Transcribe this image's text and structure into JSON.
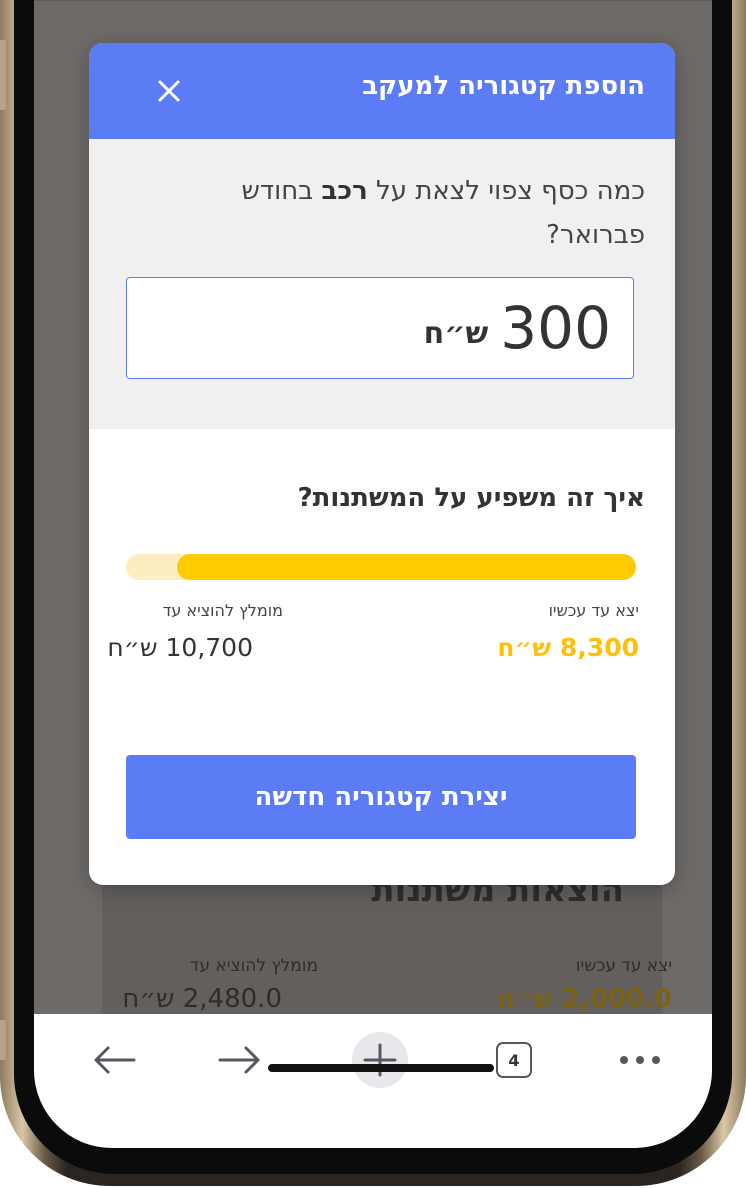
{
  "background": {
    "section_title": "הוצאות משתנות",
    "spent_label": "יצא עד עכשיו",
    "spent_value": "2,000.0 ש״ח",
    "recommended_label": "מומלץ להוציא עד",
    "recommended_value": "2,480.0 ש״ח"
  },
  "modal": {
    "title": "הוספת קטגוריה למעקב",
    "close_icon": "close-icon",
    "question_part1": "כמה כסף צפוי לצאת על",
    "question_category": "רכב",
    "question_part2": "בחודש פברואר?",
    "amount_value": "300",
    "amount_currency": "ש״ח",
    "impact_title": "איך זה משפיע על המשתנות?",
    "progress_fraction": 0.9,
    "spent_label": "יצא עד עכשיו",
    "spent_value": "8,300 ש״ח",
    "recommended_label": "מומלץ להוציא עד",
    "recommended_value": "10,700 ש״ח",
    "create_button_label": "יצירת קטגוריה חדשה"
  },
  "toolbar": {
    "back_icon": "back-arrow-icon",
    "forward_icon": "forward-arrow-icon",
    "new_tab_icon": "plus-icon",
    "tabs_count": "4",
    "menu_icon": "more-dots-icon"
  },
  "colors": {
    "accent": "#5b7cf5",
    "progress_fill": "#ffca00",
    "progress_track": "#fdeec1",
    "spent_value": "#ffc107"
  }
}
